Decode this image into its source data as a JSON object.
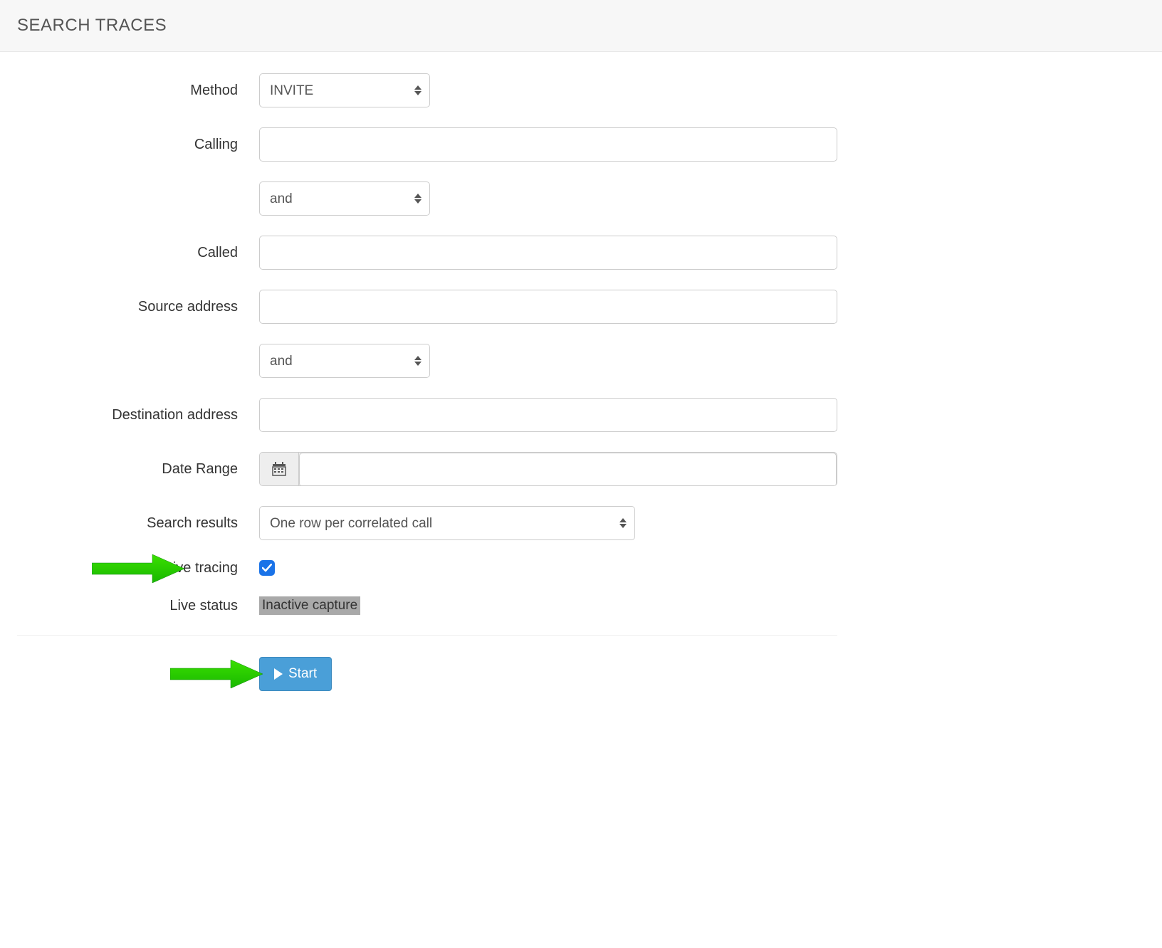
{
  "header": {
    "title": "SEARCH TRACES"
  },
  "form": {
    "method": {
      "label": "Method",
      "value": "INVITE"
    },
    "calling": {
      "label": "Calling",
      "value": ""
    },
    "logic1": {
      "value": "and"
    },
    "called": {
      "label": "Called",
      "value": ""
    },
    "source_address": {
      "label": "Source address",
      "value": ""
    },
    "logic2": {
      "value": "and"
    },
    "destination_address": {
      "label": "Destination address",
      "value": ""
    },
    "date_range": {
      "label": "Date Range",
      "value": ""
    },
    "search_results": {
      "label": "Search results",
      "value": "One row per correlated call"
    },
    "live_tracing": {
      "label": "Live tracing",
      "checked": true
    },
    "live_status": {
      "label": "Live status",
      "value": "Inactive capture"
    }
  },
  "actions": {
    "start_label": "Start"
  }
}
